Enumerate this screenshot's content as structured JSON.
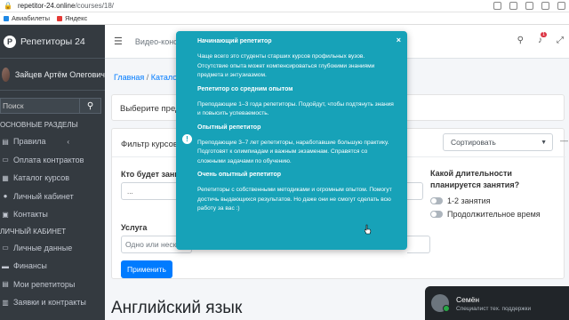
{
  "browser": {
    "url_host": "repetitor-24.online",
    "url_path": "/courses/18/",
    "bookmarks": [
      "Авиабилеты",
      "Яндекс"
    ]
  },
  "sidebar": {
    "brand": "Репетиторы 24",
    "user_name": "Зайцев Артём Олегович",
    "search_placeholder": "Поиск",
    "header_main": "ОСНОВНЫЕ РАЗДЕЛЫ",
    "main_items": [
      {
        "label": "Правила",
        "icon": "book-icon",
        "arrow": "‹"
      },
      {
        "label": "Оплата контрактов",
        "icon": "credit-card-icon"
      },
      {
        "label": "Каталог курсов",
        "icon": "catalog-icon"
      },
      {
        "label": "Личный кабинет",
        "icon": "user-icon"
      },
      {
        "label": "Контакты",
        "icon": "contacts-icon"
      }
    ],
    "header_cabinet": "ЛИЧНЫЙ КАБИНЕТ",
    "cabinet_items": [
      {
        "label": "Личные данные",
        "icon": "id-card-icon"
      },
      {
        "label": "Финансы",
        "icon": "wallet-icon"
      },
      {
        "label": "Мои репетиторы",
        "icon": "teachers-icon"
      },
      {
        "label": "Заявки и контракты",
        "icon": "contracts-icon"
      }
    ]
  },
  "topbar": {
    "link": "Видео-конс",
    "badge_count": "1"
  },
  "content": {
    "breadcrumb": [
      "Главная",
      "Катало"
    ],
    "select_prompt": "Выберите пред",
    "filter_title": "Фильтр курсов",
    "sort_label": "Сортировать",
    "who_label": "Кто будет зани",
    "who_value": "...",
    "duration_label": "Какой длительности планируется занятия?",
    "duration_options": [
      "1-2 занятия",
      "Продолжительное время"
    ],
    "service_label": "Услуга",
    "service_placeholder": "Одно или неско",
    "apply_label": "Применить",
    "section_title": "Английский язык"
  },
  "popover": {
    "sections": [
      {
        "heading": "Начинающий репетитор",
        "text": "Чаще всего это студенты старших курсов профильных вузов. Отсутствие опыта может компенсироваться глубокими знаниями предмета и энтузиазмом."
      },
      {
        "heading": "Репетитор со средним опытом",
        "text": "Преподающие 1–3 года репетиторы. Подойдут, чтобы подтянуть знания и повысить успеваемость."
      },
      {
        "heading": "Опытный репетитор",
        "text": "Преподающие 3–7 лет репетиторы, наработавшие большую практику. Подготовят к олимпиадам и важным экзаменам. Справятся со сложными задачами по обучению."
      },
      {
        "heading": "Очень опытный репетитор",
        "text": "Репетиторы с собственными методиками и огромным опытом. Помогут достичь выдающихся результатов. Но даже они не смогут сделать всю работу за вас :)"
      }
    ],
    "color": "#17a2b8"
  },
  "chat": {
    "name": "Семён",
    "role": "Специалист тех. поддержки"
  }
}
